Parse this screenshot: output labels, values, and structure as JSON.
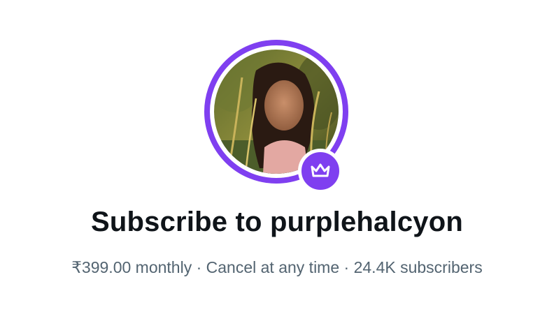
{
  "profile": {
    "avatar_icon": "profile-photo",
    "badge_icon": "crown-icon",
    "accent_color": "#7f3ff0"
  },
  "subscribe": {
    "title": "Subscribe to purplehalcyon",
    "price": "₹399.00 monthly",
    "separator": "·",
    "cancel_text": "Cancel at any time",
    "subscribers_count": "24.4K",
    "subscribers_label": "subscribers"
  }
}
